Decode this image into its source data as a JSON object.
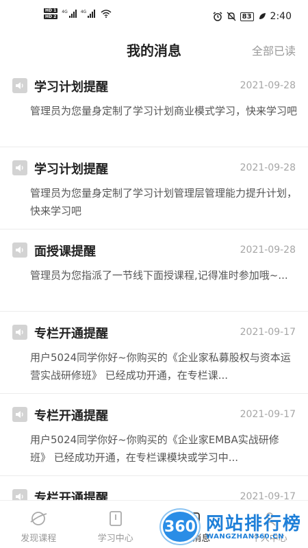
{
  "status_bar": {
    "hd1": "HD 1",
    "hd2": "HD 2",
    "sig1": "4G",
    "sig2": "4G",
    "battery": "83",
    "time": "2:40"
  },
  "header": {
    "title": "我的消息",
    "mark_all_read": "全部已读"
  },
  "messages": [
    {
      "title": "学习计划提醒",
      "date": "2021-09-28",
      "body": "管理员为您量身定制了学习计划商业模式学习，快来学习吧"
    },
    {
      "title": "学习计划提醒",
      "date": "2021-09-28",
      "body": "管理员为您量身定制了学习计划管理层管理能力提升计划，快来学习吧"
    },
    {
      "title": "面授课提醒",
      "date": "2021-09-28",
      "body": "管理员为您指派了一节线下面授课程,记得准时参加哦~..."
    },
    {
      "title": "专栏开通提醒",
      "date": "2021-09-17",
      "body": "用户5024同学你好~你购买的《企业家私募股权与资本运营实战研修班》 已经成功开通，在专栏课..."
    },
    {
      "title": "专栏开通提醒",
      "date": "2021-09-17",
      "body": "用户5024同学你好~你购买的《企业家EMBA实战研修班》 已经成功开通，在专栏课模块或学习中..."
    },
    {
      "title": "专栏开通提醒",
      "date": "2021-09-17",
      "body": ""
    }
  ],
  "tabbar": {
    "tabs": [
      {
        "label": "发现课程",
        "icon": "planet-icon"
      },
      {
        "label": "学习中心",
        "icon": "book-icon"
      },
      {
        "label": "我的消息",
        "icon": "message-icon"
      },
      {
        "label": "个人中心",
        "icon": "person-icon"
      }
    ]
  },
  "watermark": {
    "badge": "360",
    "text": "网站排行榜",
    "sub": "WANGZHAN360.CN"
  }
}
